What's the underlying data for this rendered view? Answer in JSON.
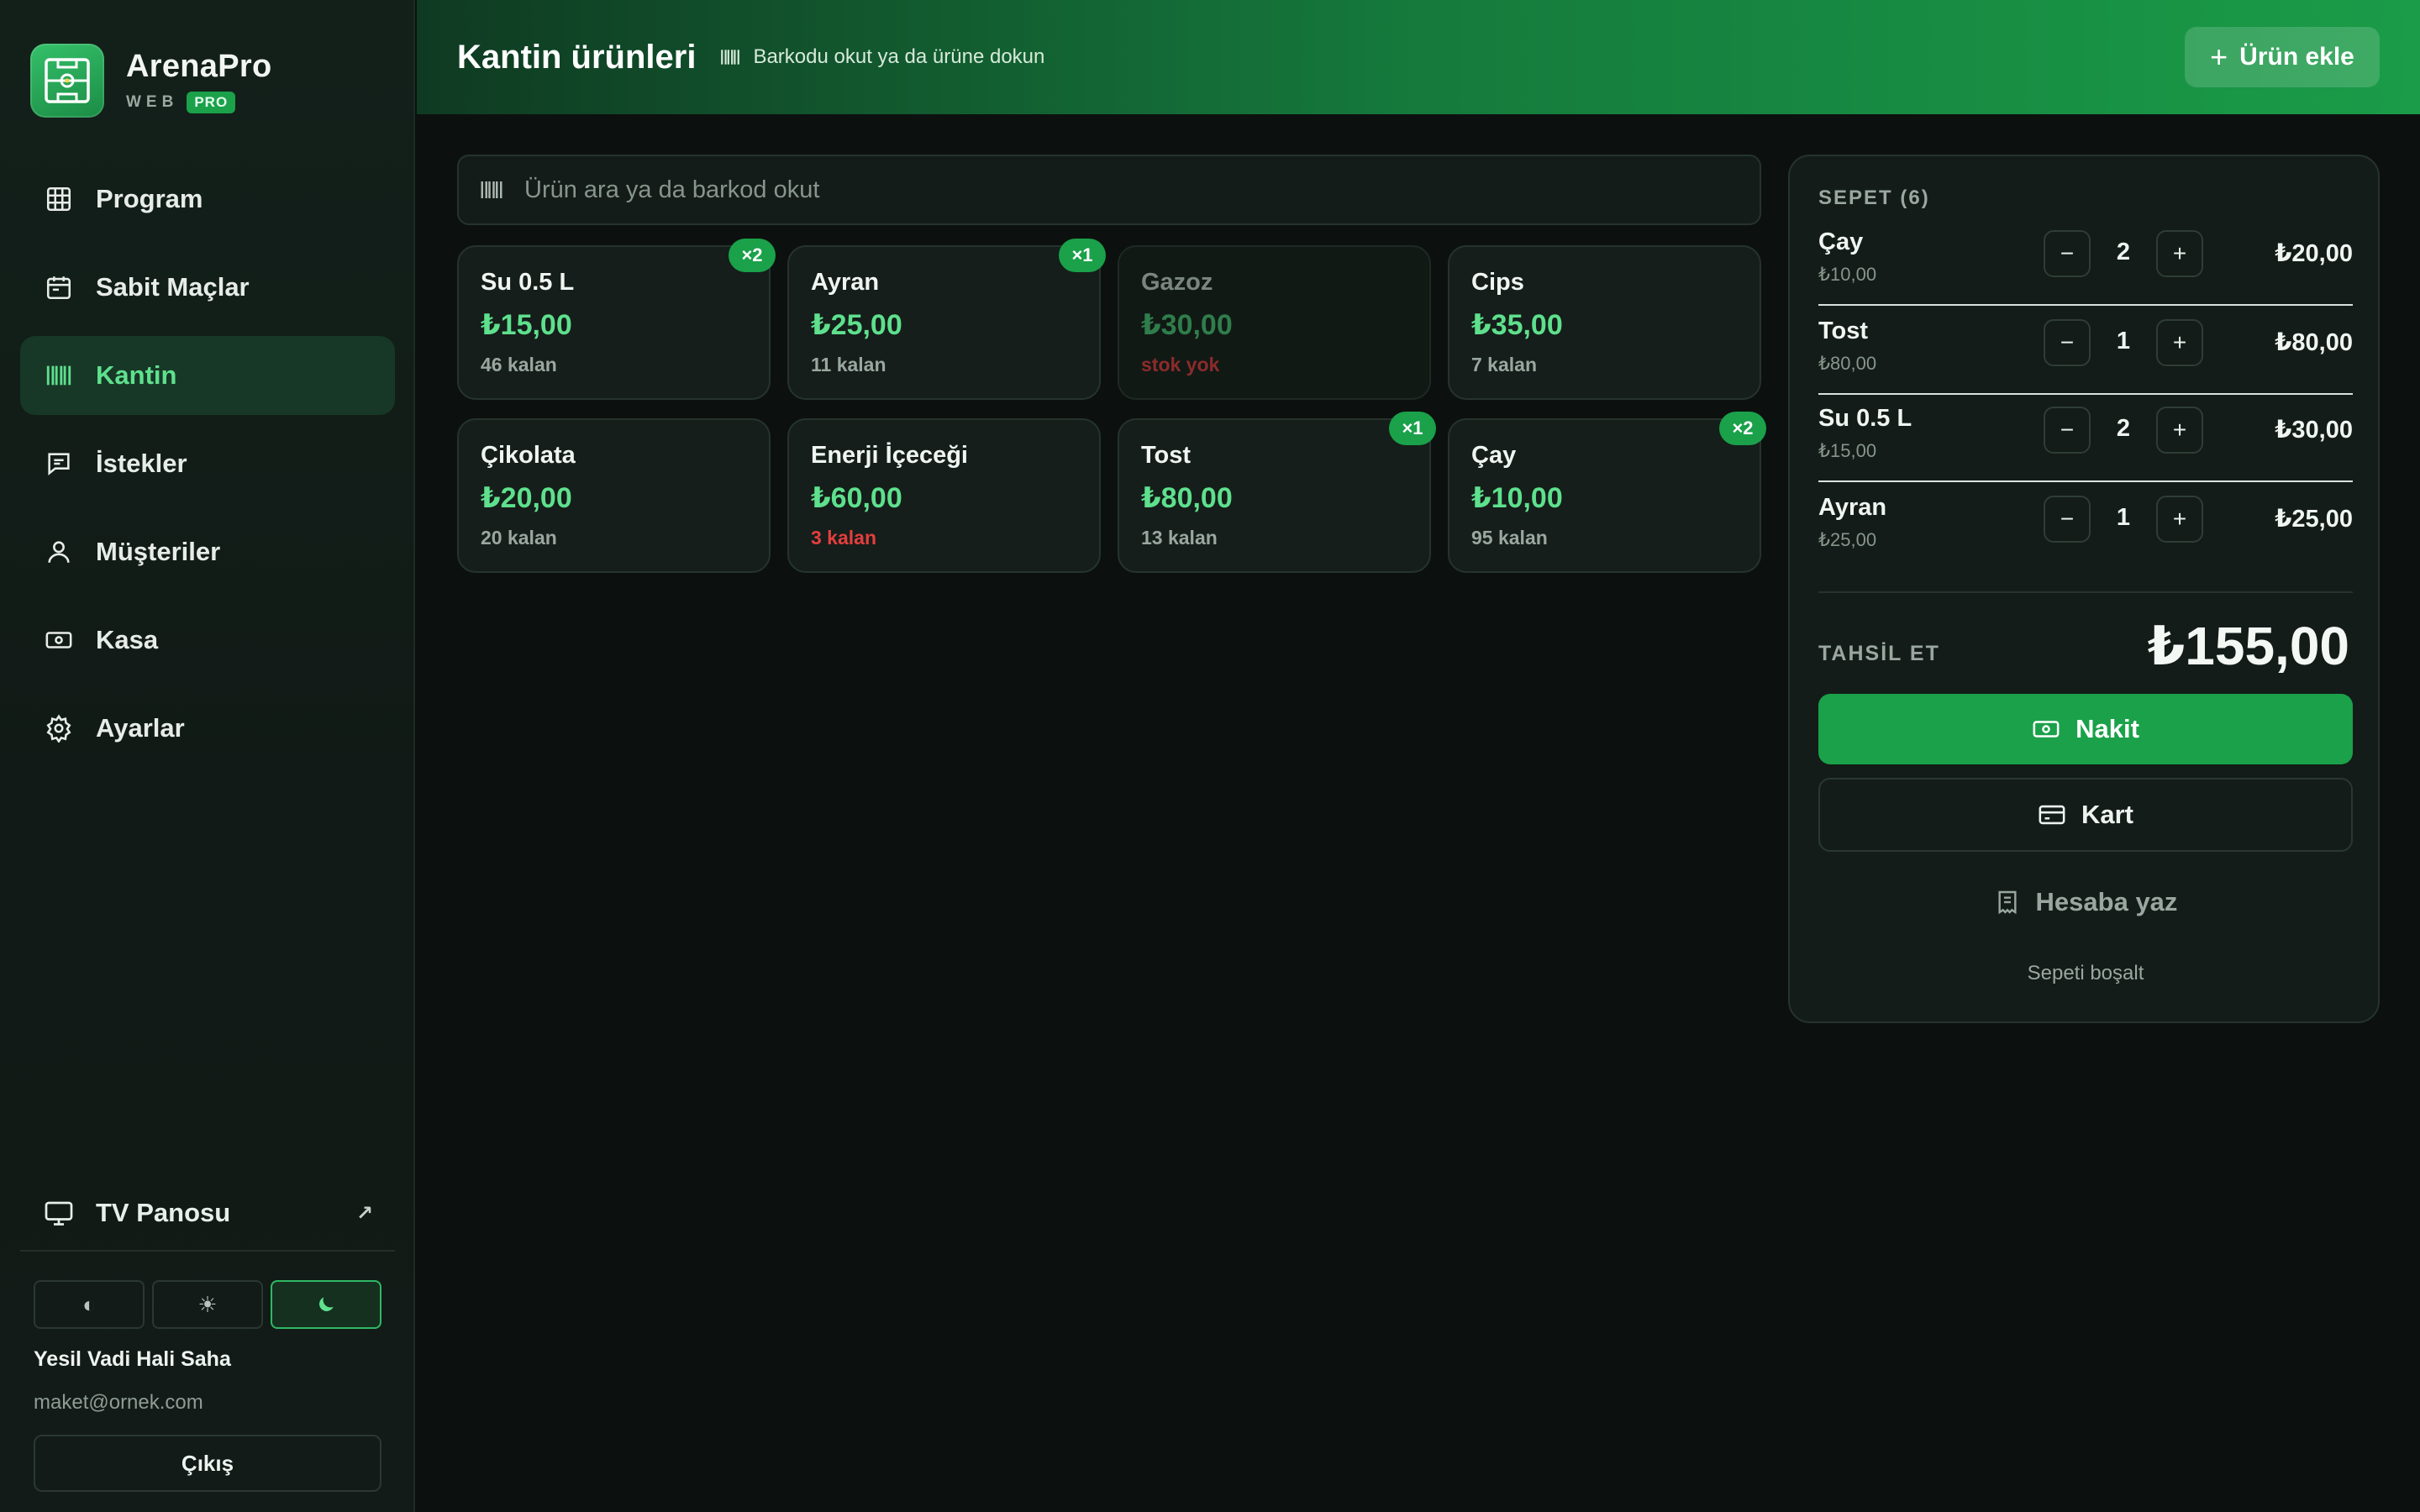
{
  "brand": {
    "name": "ArenaPro",
    "sub": "WEB",
    "tier": "PRO"
  },
  "nav": {
    "items": [
      {
        "label": "Program",
        "icon": "grid-icon"
      },
      {
        "label": "Sabit Maçlar",
        "icon": "calendar-icon"
      },
      {
        "label": "Kantin",
        "icon": "barcode-icon",
        "active": true
      },
      {
        "label": "İstekler",
        "icon": "message-icon"
      },
      {
        "label": "Müşteriler",
        "icon": "user-icon"
      },
      {
        "label": "Kasa",
        "icon": "cash-icon"
      },
      {
        "label": "Ayarlar",
        "icon": "gear-icon"
      }
    ],
    "tv": "TV Panosu",
    "tv_icon": "external-link-icon"
  },
  "theme": {
    "options": [
      "◐",
      "☀",
      "☾"
    ],
    "active_index": 2
  },
  "account": {
    "org": "Yesil Vadi Hali Saha",
    "email": "maket@ornek.com",
    "logout": "Çıkış"
  },
  "header": {
    "title": "Kantin ürünleri",
    "hint": "Barkodu okut ya da ürüne dokun",
    "add_button": "Ürün ekle"
  },
  "search": {
    "placeholder": "Ürün ara ya da barkod okut",
    "value": ""
  },
  "products": [
    {
      "name": "Su 0.5 L",
      "price": "₺15,00",
      "stock": "46 kalan",
      "badge": "×2",
      "state": "normal"
    },
    {
      "name": "Ayran",
      "price": "₺25,00",
      "stock": "11 kalan",
      "badge": "×1",
      "state": "normal"
    },
    {
      "name": "Gazoz",
      "price": "₺30,00",
      "stock": "stok yok",
      "badge": "",
      "state": "disabled"
    },
    {
      "name": "Cips",
      "price": "₺35,00",
      "stock": "7 kalan",
      "badge": "",
      "state": "normal"
    },
    {
      "name": "Çikolata",
      "price": "₺20,00",
      "stock": "20 kalan",
      "badge": "",
      "state": "normal"
    },
    {
      "name": "Enerji İçeceği",
      "price": "₺60,00",
      "stock": "3 kalan",
      "badge": "",
      "state": "low"
    },
    {
      "name": "Tost",
      "price": "₺80,00",
      "stock": "13 kalan",
      "badge": "×1",
      "state": "normal"
    },
    {
      "name": "Çay",
      "price": "₺10,00",
      "stock": "95 kalan",
      "badge": "×2",
      "state": "normal"
    }
  ],
  "cart": {
    "title": "SEPET (6)",
    "items": [
      {
        "name": "Çay",
        "unit": "₺10,00",
        "qty": "2",
        "total": "₺20,00"
      },
      {
        "name": "Tost",
        "unit": "₺80,00",
        "qty": "1",
        "total": "₺80,00"
      },
      {
        "name": "Su 0.5 L",
        "unit": "₺15,00",
        "qty": "2",
        "total": "₺30,00"
      },
      {
        "name": "Ayran",
        "unit": "₺25,00",
        "qty": "1",
        "total": "₺25,00"
      }
    ],
    "minus": "−",
    "plus": "+",
    "pay_label": "TAHSİL ET",
    "pay_total": "₺155,00",
    "cash": "Nakit",
    "card": "Kart",
    "account": "Hesaba yaz",
    "clear": "Sepeti boşalt"
  },
  "colors": {
    "accent": "#1aa14a",
    "accent_text": "#5ee08d",
    "danger": "#e53e3e",
    "bg": "#0c110f"
  }
}
